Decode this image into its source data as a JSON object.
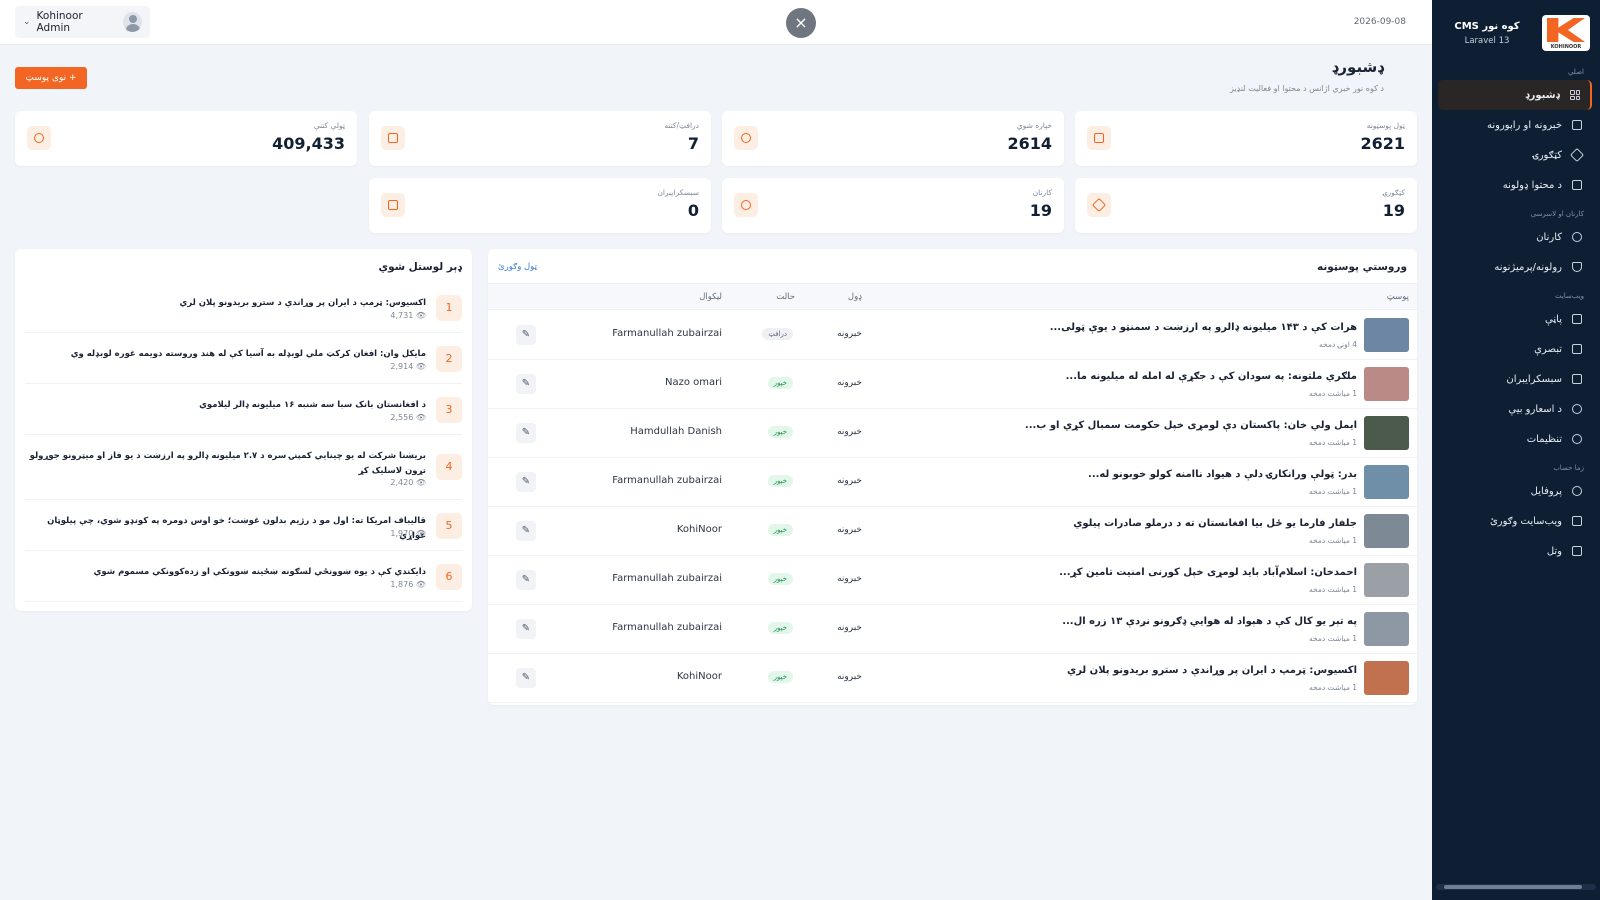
{
  "header": {
    "user_name": "Kohinoor Admin",
    "date": "2026-09-08",
    "close_symbol": "×"
  },
  "sidebar": {
    "brand_title": "کوه نور CMS",
    "brand_sub": "Laravel 13",
    "logo_text": "KOHINOOR",
    "sections": [
      "اصلي",
      "کارنان او لاسرسی",
      "ویب‌سایت",
      "زما حساب"
    ],
    "items": [
      {
        "label": "ډشبورډ",
        "icon": "grid-icon"
      },
      {
        "label": "خبرونه او راپورونه",
        "icon": "newspaper-icon"
      },
      {
        "label": "کټګورۍ",
        "icon": "tag-icon"
      },
      {
        "label": "د محتوا ډولونه",
        "icon": "folder-icon"
      },
      {
        "label": "کارنان",
        "icon": "users-icon"
      },
      {
        "label": "رولونه/پرمیژنونه",
        "icon": "shield-icon"
      },
      {
        "label": "پاڼې",
        "icon": "page-icon"
      },
      {
        "label": "تبصرې",
        "icon": "comment-icon"
      },
      {
        "label": "سبسکرایبران",
        "icon": "mail-icon"
      },
      {
        "label": "د اسعارو بیې",
        "icon": "coins-icon"
      },
      {
        "label": "تنظیمات",
        "icon": "gear-icon"
      },
      {
        "label": "پروفایل",
        "icon": "user-circle-icon"
      },
      {
        "label": "ویب‌سایت وګورئ",
        "icon": "external-link-icon"
      },
      {
        "label": "وتل",
        "icon": "logout-icon"
      }
    ]
  },
  "page": {
    "title": "ډشبورډ",
    "subtitle": "د کوه نور خبري اژانس د محتوا او فعالیت لنډیز",
    "new_post_label": "+ نوی پوسټ"
  },
  "stats": [
    {
      "label": "ټول پوسټونه",
      "value": "2621",
      "icon": "calendar-icon"
    },
    {
      "label": "خپاره شوي",
      "value": "2614",
      "icon": "check-circle-icon"
    },
    {
      "label": "درافټ/کتنه",
      "value": "7",
      "icon": "edit-icon"
    },
    {
      "label": "ټولې کتنې",
      "value": "409,433",
      "icon": "eye-icon"
    },
    {
      "label": "کټګورۍ",
      "value": "19",
      "icon": "tag-icon"
    },
    {
      "label": "کارنان",
      "value": "19",
      "icon": "users-icon"
    },
    {
      "label": "سبسکرایبران",
      "value": "0",
      "icon": "mail-icon"
    }
  ],
  "latest_posts": {
    "title": "وروستي پوسټونه",
    "see_all": "ټول وګورئ",
    "columns": {
      "post": "پوسټ",
      "type": "ډول",
      "status": "حالت",
      "author": "لیکوال"
    },
    "rows": [
      {
        "title": "هرات کې د ۱۴۳ میلیونه ډالرو په ارزښت د سمنټو د یوې ټولی...",
        "meta": "4 اونۍ دمخه",
        "type": "خبرونه",
        "status": "درافټ",
        "status_kind": "draft",
        "author": "Farmanullah zubairzai",
        "thumb": "#6d86a3"
      },
      {
        "title": "ملګري ملتونه: په سودان کې د جګړې له امله له میلیونه ما...",
        "meta": "1 میاشت دمخه",
        "type": "خبرونه",
        "status": "خپور",
        "status_kind": "pub",
        "author": "Nazo omari",
        "thumb": "#b98a86"
      },
      {
        "title": "ایمل ولي خان: پاکستان دې لومړی خپل حکومت سمبال کړي او ب...",
        "meta": "1 میاشت دمخه",
        "type": "خبرونه",
        "status": "خپور",
        "status_kind": "pub",
        "author": "Hamdullah Danish",
        "thumb": "#4b5a4a"
      },
      {
        "title": "بدر: ټولې ورانکارۍ دلې د هیواد ناامنه کولو خوبونو له...",
        "meta": "1 میاشت دمخه",
        "type": "خبرونه",
        "status": "خپور",
        "status_kind": "pub",
        "author": "Farmanullah zubairzai",
        "thumb": "#6f8fa8"
      },
      {
        "title": "جلفار فارما یو ځل بیا افغانستان ته د درملو صادرات پیلوي",
        "meta": "1 میاشت دمخه",
        "type": "خبرونه",
        "status": "خپور",
        "status_kind": "pub",
        "author": "KohiNoor",
        "thumb": "#7d8a96"
      },
      {
        "title": "احمدخان: اسلام‌آباد باید لومړی خپل کورنی امنیت تامین کړ...",
        "meta": "1 میاشت دمخه",
        "type": "خبرونه",
        "status": "خپور",
        "status_kind": "pub",
        "author": "Farmanullah zubairzai",
        "thumb": "#9aa0a6"
      },
      {
        "title": "په تېر یو کال کې د هېواد له هوايي ډګرونو نږدې ۱۳ زره ال...",
        "meta": "1 میاشت دمخه",
        "type": "خبرونه",
        "status": "خپور",
        "status_kind": "pub",
        "author": "Farmanullah zubairzai",
        "thumb": "#8d98a4"
      },
      {
        "title": "اکسیوس: ټرمپ د ایران پر وړاندې د سترو بریدونو پلان لري",
        "meta": "1 میاشت دمخه",
        "type": "خبرونه",
        "status": "خپور",
        "status_kind": "pub",
        "author": "KohiNoor",
        "thumb": "#c2714f"
      }
    ]
  },
  "most_read": {
    "title": "ډېر لوستل شوي",
    "items": [
      {
        "rank": "1",
        "title": "اکسیوس: ټرمپ د ایران پر وړاندې د سترو بریدونو پلان لري",
        "views": "4,731"
      },
      {
        "rank": "2",
        "title": "مایکل وان: افغان کرکټ ملي لوبډله به آسیا کې له هند وروسته دویمه غوره لوبډله وي",
        "views": "2,914"
      },
      {
        "rank": "3",
        "title": "د افغانستان بانک سبا سه شنبه ۱۶ میلیونه ډالر لیلاموي",
        "views": "2,556"
      },
      {
        "rank": "4",
        "title": "بریښنا شرکت له یو چینایي کمپنۍ سره د ۲.۷ میلیونه ډالرو په ارزښت د یو فاز او میټرونو جوړولو تړون لاسلیک کړ",
        "views": "2,420"
      },
      {
        "rank": "5",
        "title": "قالیباف امریکا ته: اول مو د رژیم بدلون غوښت؛ خو اوس دومره په کونډو شوي، چې پیلوټان غواړي",
        "views": "1,970"
      },
      {
        "rank": "6",
        "title": "دایکندي کې د یوه ښوونځي لسګونه ښځینه ښوونکي او زده‌کوونکي مسموم شوي",
        "views": "1,876"
      }
    ]
  }
}
